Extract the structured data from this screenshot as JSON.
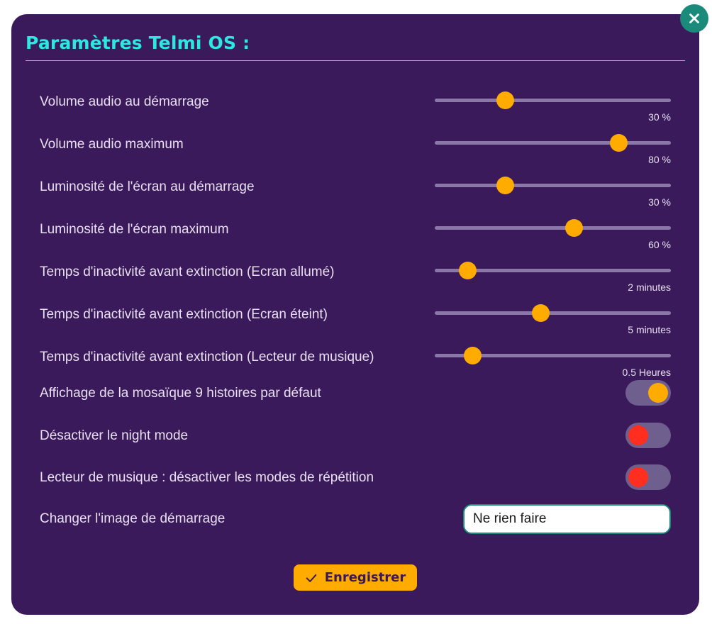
{
  "dialog": {
    "title": "Paramètres Telmi OS :",
    "close_icon": "close-icon"
  },
  "sliders": [
    {
      "label": "Volume audio au démarrage",
      "value_text": "30 %",
      "fraction": 0.3
    },
    {
      "label": "Volume audio maximum",
      "value_text": "80 %",
      "fraction": 0.78
    },
    {
      "label": "Luminosité de l'écran au démarrage",
      "value_text": "30 %",
      "fraction": 0.3
    },
    {
      "label": "Luminosité de l'écran maximum",
      "value_text": "60 %",
      "fraction": 0.59
    },
    {
      "label": "Temps d'inactivité avant extinction (Ecran allumé)",
      "value_text": "2 minutes",
      "fraction": 0.14
    },
    {
      "label": "Temps d'inactivité avant extinction (Ecran éteint)",
      "value_text": "5 minutes",
      "fraction": 0.45
    },
    {
      "label": "Temps d'inactivité avant extinction (Lecteur de musique)",
      "value_text": "0.5 Heures",
      "fraction": 0.16
    }
  ],
  "toggles": [
    {
      "label": "Affichage de la mosaïque 9 histoires par défaut",
      "state": "on"
    },
    {
      "label": "Désactiver le night mode",
      "state": "off"
    },
    {
      "label": "Lecteur de musique : désactiver les modes de répétition",
      "state": "off"
    }
  ],
  "startup_image": {
    "label": "Changer l'image de démarrage",
    "selected": "Ne rien faire"
  },
  "save_button": {
    "label": "Enregistrer",
    "icon": "check-icon"
  },
  "colors": {
    "background": "#3b1a5c",
    "accent": "#2ce8e0",
    "thumb": "#ffab00",
    "toggle_off": "#ff2e1f",
    "close": "#1a8a7a"
  }
}
